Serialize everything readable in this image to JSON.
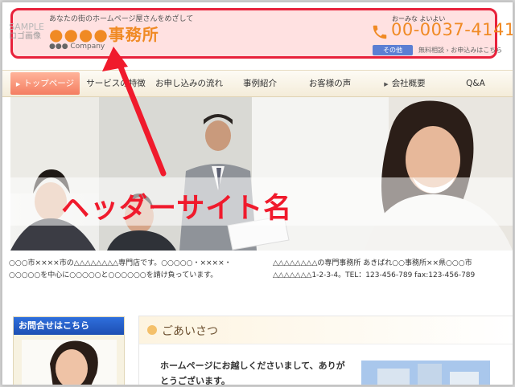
{
  "header": {
    "logo_line1": "SAMPLE",
    "logo_line2": "ロゴ画像",
    "tagline": "あなたの街のホームページ屋さんをめざして",
    "site_name": "●●●●事務所",
    "company": "●●● Company",
    "phone_kana": "おーみな よいよい",
    "phone_number": "00-0037-4141",
    "other_button": "その他",
    "sub_links": "無料相談 › お申込みはこちら"
  },
  "nav": {
    "items": [
      {
        "label": "トップページ"
      },
      {
        "label": "サービスの特徴"
      },
      {
        "label": "お申し込みの流れ"
      },
      {
        "label": "事例紹介"
      },
      {
        "label": "お客様の声"
      },
      {
        "label": "会社概要"
      },
      {
        "label": "Q&A"
      }
    ]
  },
  "hero": {
    "caption": "ヘッダーサイト名"
  },
  "description": {
    "left": "○○○市××××市の△△△△△△△△専門店です。○○○○○・××××・○○○○○を中心に○○○○○と○○○○○○を請け負っています。",
    "right_line1": "△△△△△△△△の専門事務所 あきばれ○○事務所××県○○○市",
    "right_line2": "△△△△△△△1-2-3-4。TEL：123-456-789 fax:123-456-789"
  },
  "sidebar": {
    "contact_title": "お問合せはこちら"
  },
  "greeting": {
    "title": "ごあいさつ",
    "body": "ホームページにお越しくださいまして、ありがとうございます。"
  },
  "colors": {
    "accent_orange": "#f08a24",
    "highlight_red": "#e8213b",
    "nav_active": "#f47d61",
    "contact_blue": "#1d4fb3"
  }
}
